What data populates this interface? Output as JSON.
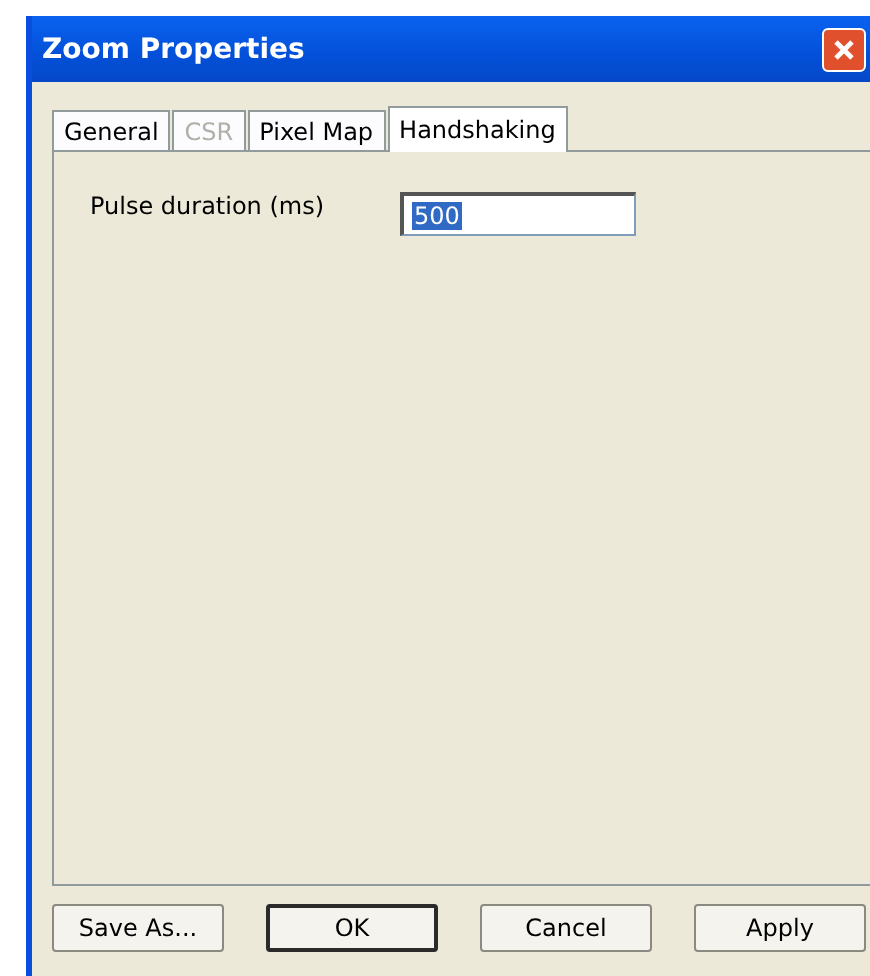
{
  "window": {
    "title": "Zoom Properties"
  },
  "tabs": [
    {
      "label": "General",
      "selected": false,
      "disabled": false
    },
    {
      "label": "CSR",
      "selected": false,
      "disabled": true
    },
    {
      "label": "Pixel Map",
      "selected": false,
      "disabled": false
    },
    {
      "label": "Handshaking",
      "selected": true,
      "disabled": false
    }
  ],
  "fields": [
    {
      "label": "Pulse duration (ms)",
      "value": "500",
      "text_selected": true
    }
  ],
  "buttons": [
    {
      "label": "Save As...",
      "default": false
    },
    {
      "label": "OK",
      "default": true
    },
    {
      "label": "Cancel",
      "default": false
    },
    {
      "label": "Apply",
      "default": false
    }
  ]
}
